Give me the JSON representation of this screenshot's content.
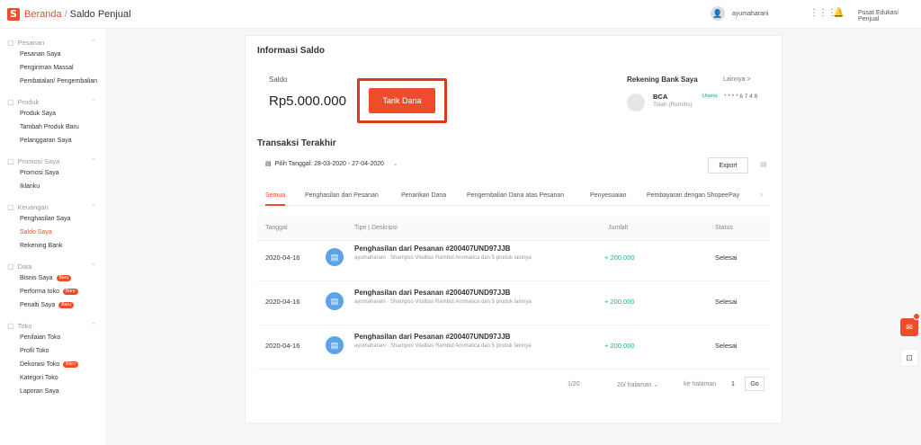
{
  "header": {
    "breadcrumb_root": "Beranda",
    "breadcrumb_sep": "/",
    "breadcrumb_current": "Saldo Penjual",
    "username": "ayumaharani",
    "help_link": "Pusat Edukasi Penjual"
  },
  "sidebar": [
    {
      "title": "Pesanan",
      "icon": "clipboard-icon",
      "items": [
        {
          "label": "Pesanan Saya"
        },
        {
          "label": "Pengiriman Massal"
        },
        {
          "label": "Pembatalan/ Pengembalian"
        }
      ]
    },
    {
      "title": "Produk",
      "icon": "box-icon",
      "items": [
        {
          "label": "Produk Saya"
        },
        {
          "label": "Tambah Produk Baru"
        },
        {
          "label": "Pelanggaran Saya"
        }
      ]
    },
    {
      "title": "Promosi Saya",
      "icon": "tag-icon",
      "items": [
        {
          "label": "Promosi Saya"
        },
        {
          "label": "Iklanku"
        }
      ]
    },
    {
      "title": "Keuangan",
      "icon": "wallet-icon",
      "items": [
        {
          "label": "Penghasilan Saya"
        },
        {
          "label": "Saldo Saya",
          "active": true
        },
        {
          "label": "Rekening Bank"
        }
      ]
    },
    {
      "title": "Data",
      "icon": "chart-icon",
      "items": [
        {
          "label": "Bisnis Saya",
          "badge": "Baru"
        },
        {
          "label": "Performa toko",
          "badge": "Baru"
        },
        {
          "label": "Penalti Saya",
          "badge": "Baru"
        }
      ]
    },
    {
      "title": "Toko",
      "icon": "shop-icon",
      "items": [
        {
          "label": "Penilaian Toko"
        },
        {
          "label": "Profil Toko"
        },
        {
          "label": "Dekorasi Toko",
          "badge": "Baru"
        },
        {
          "label": "Kategori Toko"
        },
        {
          "label": "Laporan Saya"
        }
      ]
    }
  ],
  "info": {
    "title": "Informasi Saldo",
    "saldo_label": "Saldo",
    "saldo_value": "Rp5.000.000",
    "withdraw_button": "Tarik Dana"
  },
  "bank": {
    "title": "Rekening Bank Saya",
    "more": "Lainnya >",
    "name": "BCA",
    "verified": "Utama",
    "number": "* * * * 6 7 4 8",
    "holder": "Tolah (Rumihs)"
  },
  "transactions": {
    "title": "Transaksi Terakhir",
    "date_filter": "Pilih Tanggal: 28-03-2020 - 27-04-2020",
    "export": "Export",
    "tabs": [
      "Semua",
      "Penghasilan dari Pesanan",
      "Penarikan Dana",
      "Pengembalian Dana atas Pesanan",
      "Penyesuaian",
      "Pembayaran dengan ShopeePay"
    ],
    "columns": [
      "Tanggal",
      "Tipe | Deskripsi",
      "Jumlah",
      "Status"
    ],
    "rows": [
      {
        "date": "2020-04-16",
        "title": "Penghasilan dari Pesanan #200407UND97JJB",
        "desc": "ayumaharani · Shampoo Vitalitas Rambut Aromatica dan 5 produk lainnya",
        "amount": "+ 200.000",
        "status": "Selesai"
      },
      {
        "date": "2020-04-16",
        "title": "Penghasilan dari Pesanan #200407UND97JJB",
        "desc": "ayumaharani · Shampoo Vitalitas Rambut Aromatica dan 5 produk lainnya",
        "amount": "+ 200.000",
        "status": "Selesai"
      },
      {
        "date": "2020-04-16",
        "title": "Penghasilan dari Pesanan #200407UND97JJB",
        "desc": "ayumaharani · Shampoo Vitalitas Rambut Aromatica dan 5 produk lainnya",
        "amount": "+ 200.000",
        "status": "Selesai"
      }
    ]
  },
  "pagination": {
    "page_info": "1/20",
    "per_page": "20/ halaman",
    "goto_label": "ke halaman",
    "goto_value": "1",
    "go": "Go"
  },
  "colors": {
    "accent": "#ee4d2d",
    "positive": "#26aa99",
    "highlight": "#d93b1d"
  }
}
